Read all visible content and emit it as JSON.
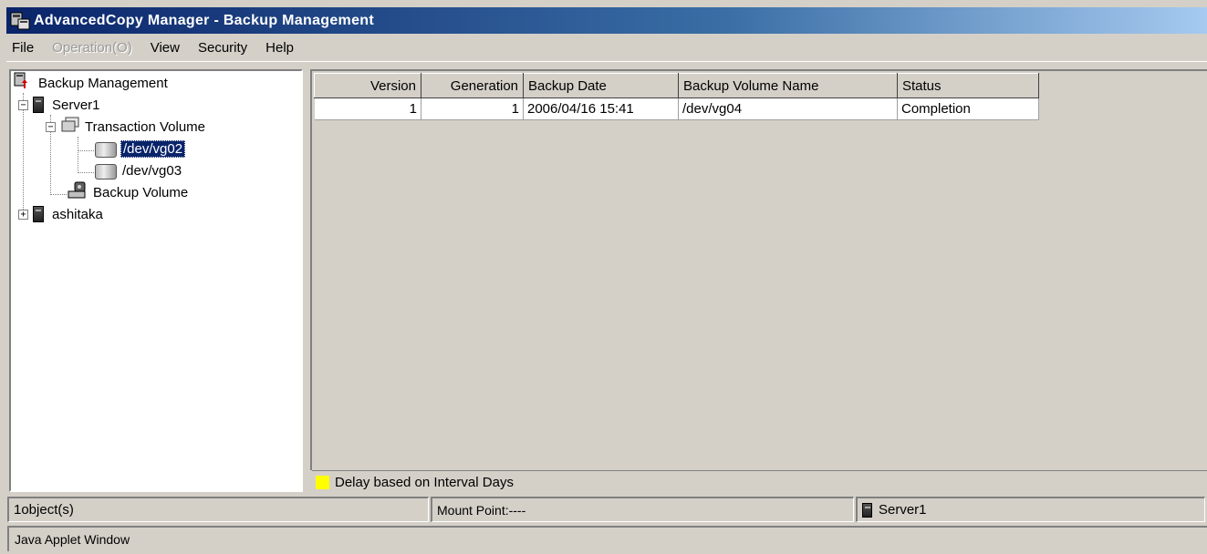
{
  "window": {
    "title": "AdvancedCopy Manager - Backup Management"
  },
  "menu": [
    {
      "label": "File",
      "enabled": true
    },
    {
      "label": "Operation(O)",
      "enabled": false
    },
    {
      "label": "View",
      "enabled": true
    },
    {
      "label": "Security",
      "enabled": true
    },
    {
      "label": "Help",
      "enabled": true
    }
  ],
  "tree": {
    "root": "Backup Management",
    "server1": "Server1",
    "transaction_volume": "Transaction Volume",
    "vg02": "/dev/vg02",
    "vg03": "/dev/vg03",
    "backup_volume": "Backup Volume",
    "ashitaka": "ashitaka"
  },
  "table": {
    "columns": [
      "Version",
      "Generation",
      "Backup Date",
      "Backup Volume Name",
      "Status"
    ],
    "rows": [
      {
        "version": "1",
        "generation": "1",
        "backup_date": "2006/04/16 15:41",
        "volume": "/dev/vg04",
        "status": "Completion"
      }
    ]
  },
  "legend": {
    "label": "Delay based on Interval Days",
    "color": "#ffff00"
  },
  "status": {
    "objects": "1object(s)",
    "mount_point": "Mount Point:----",
    "server": "Server1"
  },
  "applet_label": "Java Applet Window"
}
